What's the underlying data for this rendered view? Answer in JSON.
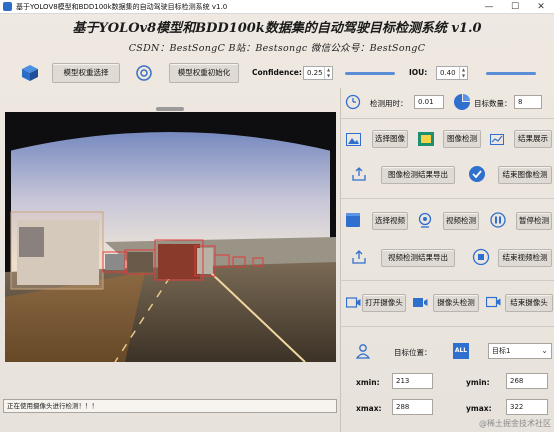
{
  "window": {
    "title": "基于YOLOV8模型和BDD100k数据集的自动驾驶目标检测系统 v1.0"
  },
  "header": {
    "title": "基于YOLOv8模型和BDD100k数据集的自动驾驶目标检测系统 v1.0",
    "subtitle": "CSDN：BestSongC   B站：Bestsongc   微信公众号：BestSongC"
  },
  "toolbar": {
    "select_model_label": "模型权重选择",
    "init_model_label": "模型权重初始化",
    "confidence_label": "Confidence:",
    "confidence_value": "0.25",
    "iou_label": "IOU:",
    "iou_value": "0.40"
  },
  "stats": {
    "time_label": "检测用时：",
    "time_value": "0.01",
    "count_label": "目标数量：",
    "count_value": "8"
  },
  "image_ops": {
    "select_label": "选择图像",
    "detect_label": "图像检测",
    "show_label": "结果展示",
    "export_label": "图像检测结果导出",
    "finish_label": "结束图像检测"
  },
  "video_ops": {
    "select_label": "选择视频",
    "detect_label": "视频检测",
    "pause_label": "暂停检测",
    "export_label": "视频检测结果导出",
    "finish_label": "结束视频检测"
  },
  "camera_ops": {
    "open_label": "打开摄像头",
    "detect_label": "摄像头检测",
    "finish_label": "结束摄像头"
  },
  "target": {
    "position_label": "目标位置：",
    "select_value": "目标1",
    "xmin_label": "xmin:",
    "xmin_value": "213",
    "ymin_label": "ymin:",
    "ymin_value": "268",
    "xmax_label": "xmax:",
    "xmax_value": "288",
    "ymax_label": "ymax:",
    "ymax_value": "322"
  },
  "status": {
    "text": "正在使用摄像头进行检测！！！"
  },
  "watermark": "@稀土掘金技术社区",
  "colors": {
    "accent": "#2f6fce",
    "detect_box": "#e03a3a"
  }
}
